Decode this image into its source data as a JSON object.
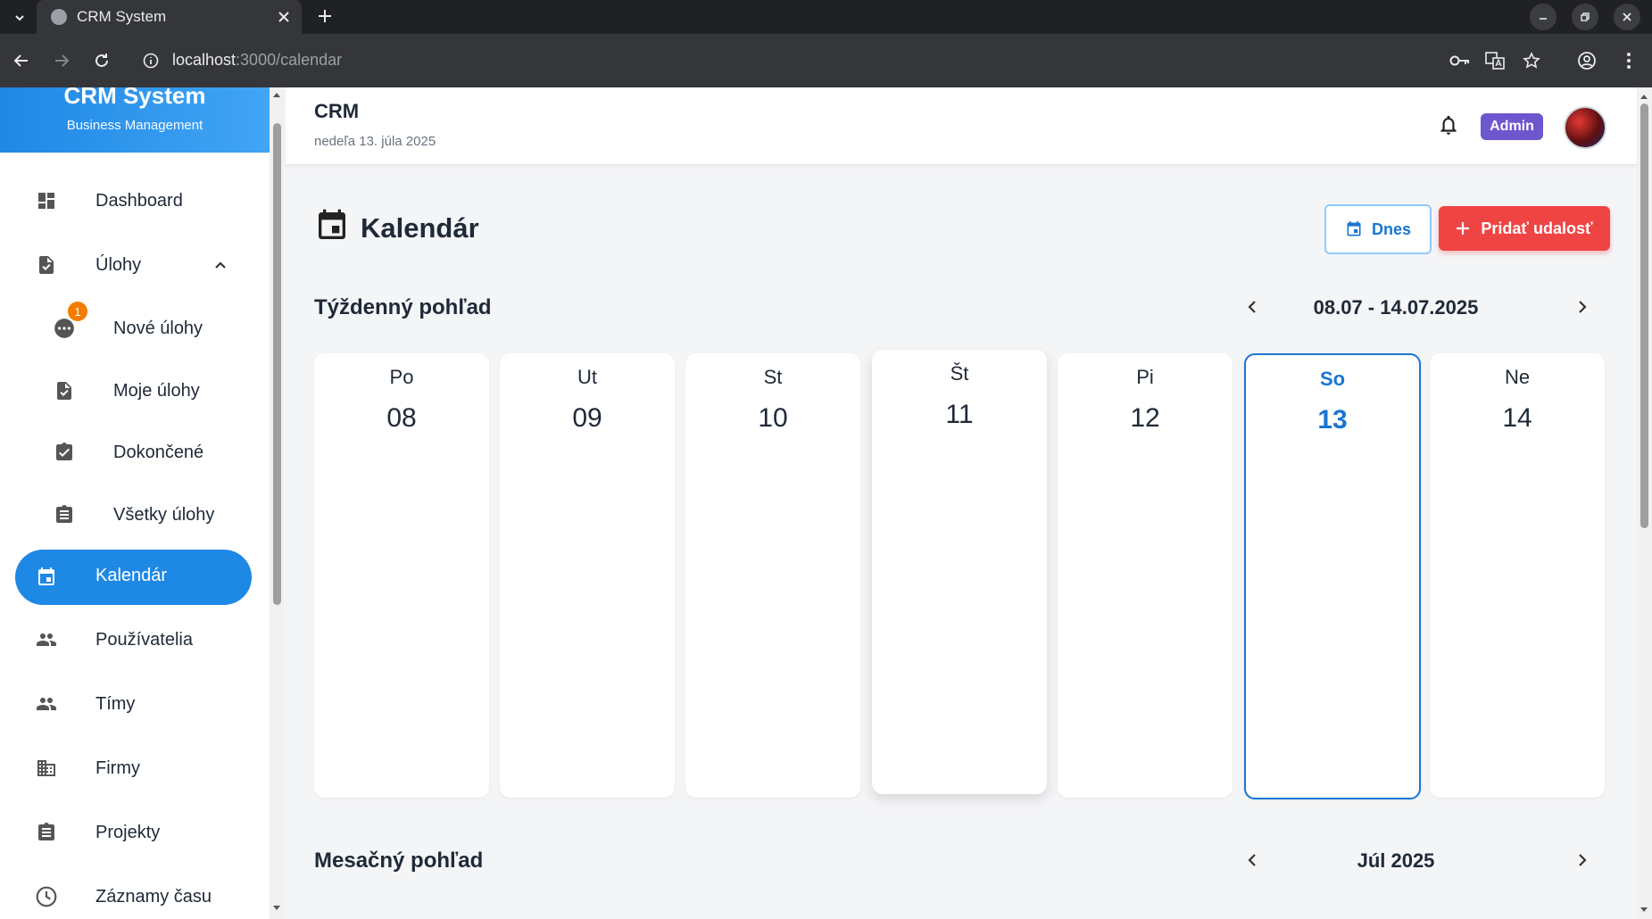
{
  "browser": {
    "tab_title": "CRM System",
    "url_host": "localhost",
    "url_path": ":3000/calendar"
  },
  "sidebar": {
    "brand_name": "CRM System",
    "brand_sub": "Business Management",
    "items": [
      {
        "label": "Dashboard",
        "icon": "dashboard-icon"
      },
      {
        "label": "Úlohy",
        "icon": "task-icon"
      },
      {
        "label": "Nové úlohy",
        "icon": "pending-icon",
        "badge": "1"
      },
      {
        "label": "Moje úlohy",
        "icon": "task-icon"
      },
      {
        "label": "Dokončené",
        "icon": "check-icon"
      },
      {
        "label": "Všetky úlohy",
        "icon": "assignment-icon"
      },
      {
        "label": "Kalendár",
        "icon": "calendar-icon",
        "active": true
      },
      {
        "label": "Používatelia",
        "icon": "people-icon"
      },
      {
        "label": "Tímy",
        "icon": "people-icon"
      },
      {
        "label": "Firmy",
        "icon": "business-icon"
      },
      {
        "label": "Projekty",
        "icon": "assignment-icon"
      },
      {
        "label": "Záznamy času",
        "icon": "clock-icon"
      }
    ]
  },
  "header": {
    "title": "CRM",
    "date": "nedeľa 13. júla 2025",
    "role_badge": "Admin"
  },
  "page": {
    "title": "Kalendár",
    "today_button": "Dnes",
    "add_button": "Pridať udalosť"
  },
  "weekly": {
    "title": "Týždenný pohľad",
    "range": "08.07 - 14.07.2025",
    "days": [
      {
        "name": "Po",
        "date": "08"
      },
      {
        "name": "Ut",
        "date": "09"
      },
      {
        "name": "St",
        "date": "10"
      },
      {
        "name": "Št",
        "date": "11"
      },
      {
        "name": "Pi",
        "date": "12"
      },
      {
        "name": "So",
        "date": "13"
      },
      {
        "name": "Ne",
        "date": "14"
      }
    ]
  },
  "monthly": {
    "title": "Mesačný pohľad",
    "month": "Júl 2025"
  },
  "colors": {
    "primary": "#1e88e5",
    "accent_red": "#ef4444",
    "admin_badge": "#6e56cf",
    "badge_orange": "#f57c00"
  }
}
